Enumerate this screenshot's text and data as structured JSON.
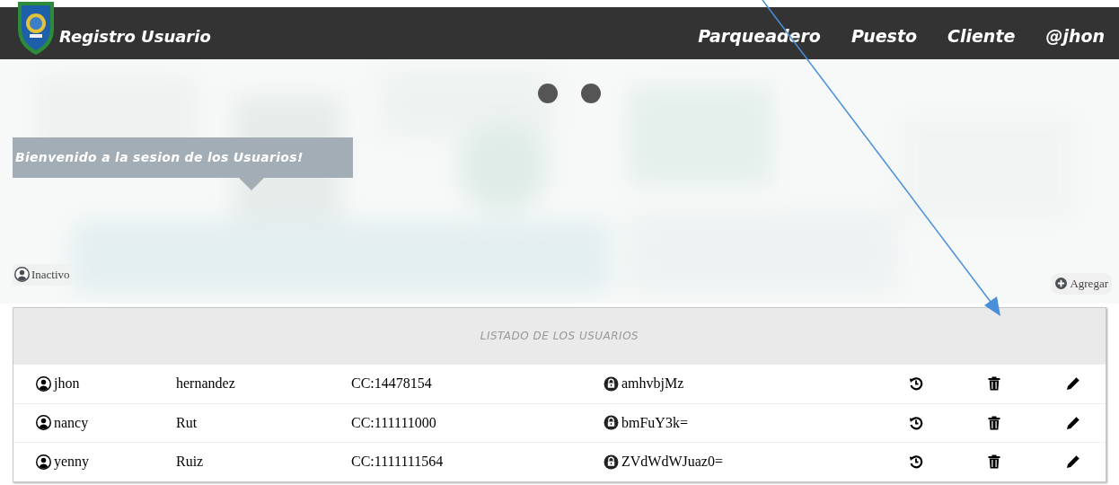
{
  "header": {
    "title": "Registro Usuario",
    "nav": [
      "Parqueadero",
      "Puesto",
      "Cliente",
      "@jhon"
    ]
  },
  "banner": "Bienvenido a la sesion de los Usuarios!",
  "inactive_button": "Inactivo",
  "add_button": "Agregar",
  "table": {
    "title": "LISTADO DE LOS USUARIOS",
    "rows": [
      {
        "name": "jhon",
        "surname": "hernandez",
        "document": "CC:14478154",
        "password": "amhvbjMz"
      },
      {
        "name": "nancy",
        "surname": "Rut",
        "document": "CC:111111000",
        "password": "bmFuY3k="
      },
      {
        "name": "yenny",
        "surname": "Ruiz",
        "document": "CC:1111111564",
        "password": "ZVdWdWJuaz0="
      }
    ]
  }
}
